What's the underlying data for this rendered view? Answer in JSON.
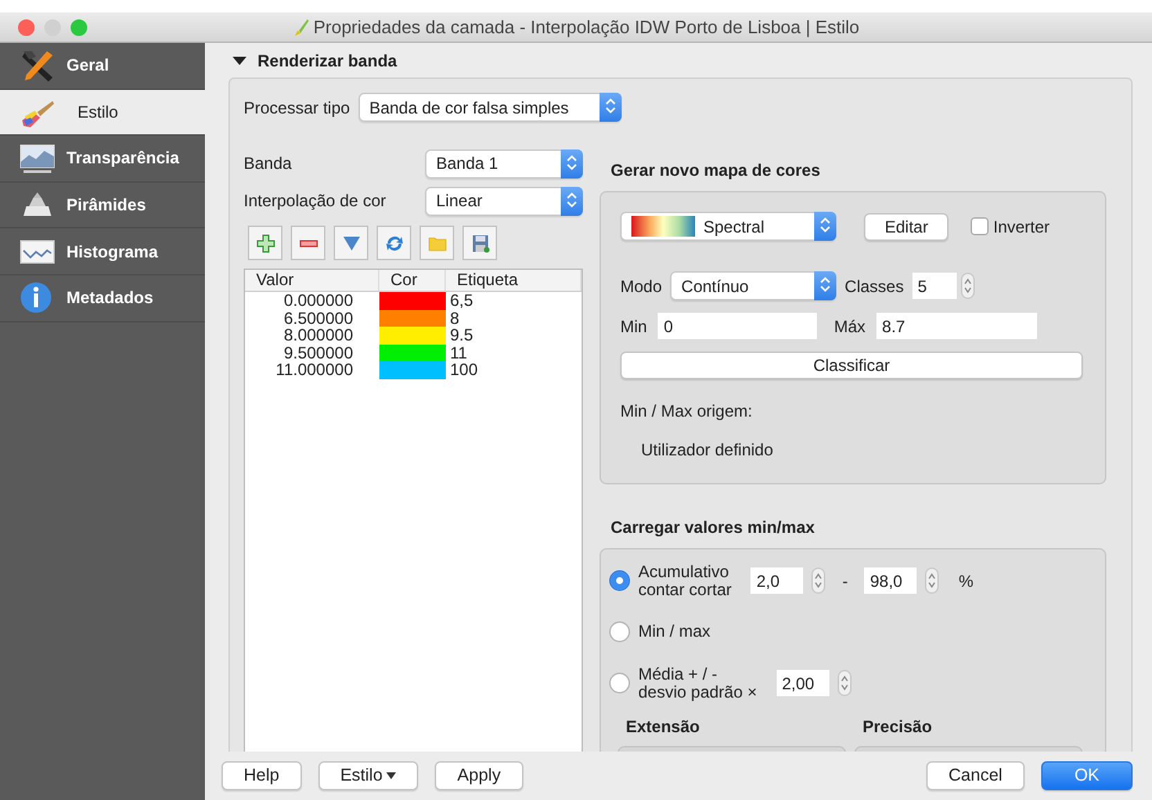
{
  "window": {
    "title": "Propriedades da camada - Interpolação IDW Porto de Lisboa | Estilo"
  },
  "sidebar": {
    "items": [
      {
        "label": "Geral",
        "selected": false
      },
      {
        "label": "Estilo",
        "selected": true
      },
      {
        "label": "Transparência",
        "selected": false
      },
      {
        "label": "Pirâmides",
        "selected": false
      },
      {
        "label": "Histograma",
        "selected": false
      },
      {
        "label": "Metadados",
        "selected": false
      }
    ]
  },
  "section": {
    "title": "Renderizar banda",
    "expanded": true,
    "render_type": {
      "label": "Processar tipo",
      "value": "Banda de cor falsa simples"
    },
    "band": {
      "label": "Banda",
      "value": "Banda 1"
    },
    "interpolation": {
      "label": "Interpolação de cor",
      "value": "Linear"
    },
    "table": {
      "columns": [
        "Valor",
        "Cor",
        "Etiqueta"
      ],
      "rows": [
        {
          "value": "0.000000",
          "color": "#ff0000",
          "label": "6,5"
        },
        {
          "value": "6.500000",
          "color": "#ff7f00",
          "label": "8"
        },
        {
          "value": "8.000000",
          "color": "#ffee00",
          "label": "9.5"
        },
        {
          "value": "9.500000",
          "color": "#00ee00",
          "label": "11"
        },
        {
          "value": "11.000000",
          "color": "#00bfff",
          "label": "100"
        }
      ]
    },
    "color_map": {
      "title": "Gerar novo mapa de cores",
      "ramp": "Spectral",
      "edit_button": "Editar",
      "invert": {
        "label": "Inverter",
        "checked": false
      },
      "mode": {
        "label": "Modo",
        "value": "Contínuo"
      },
      "classes": {
        "label": "Classes",
        "value": "5"
      },
      "min": {
        "label": "Min",
        "value": "0"
      },
      "max": {
        "label": "Máx",
        "value": "8.7"
      },
      "classify_button": "Classificar",
      "origin_label": "Min / Max origem:",
      "origin_value": "Utilizador definido"
    },
    "minmax": {
      "title": "Carregar valores min/max",
      "options": [
        {
          "kind": "range",
          "label": "Acumulativo\ncontar cortar",
          "selected": true,
          "from": "2,0",
          "separator": "-",
          "to": "98,0",
          "unit": "%"
        },
        {
          "kind": "plain",
          "label": "Min / max",
          "selected": false
        },
        {
          "kind": "factor",
          "label": "Média + / -\ndesvio padrão ×",
          "selected": false,
          "factor": "2,00"
        }
      ],
      "subgroups": [
        "Extensão",
        "Precisão"
      ]
    }
  },
  "footer": {
    "left_buttons": [
      {
        "label": "Help",
        "dropdown": false
      },
      {
        "label": "Estilo",
        "dropdown": true
      },
      {
        "label": "Apply",
        "dropdown": false
      }
    ],
    "right_buttons": [
      {
        "label": "Cancel",
        "default": false
      },
      {
        "label": "OK",
        "default": true
      }
    ]
  }
}
